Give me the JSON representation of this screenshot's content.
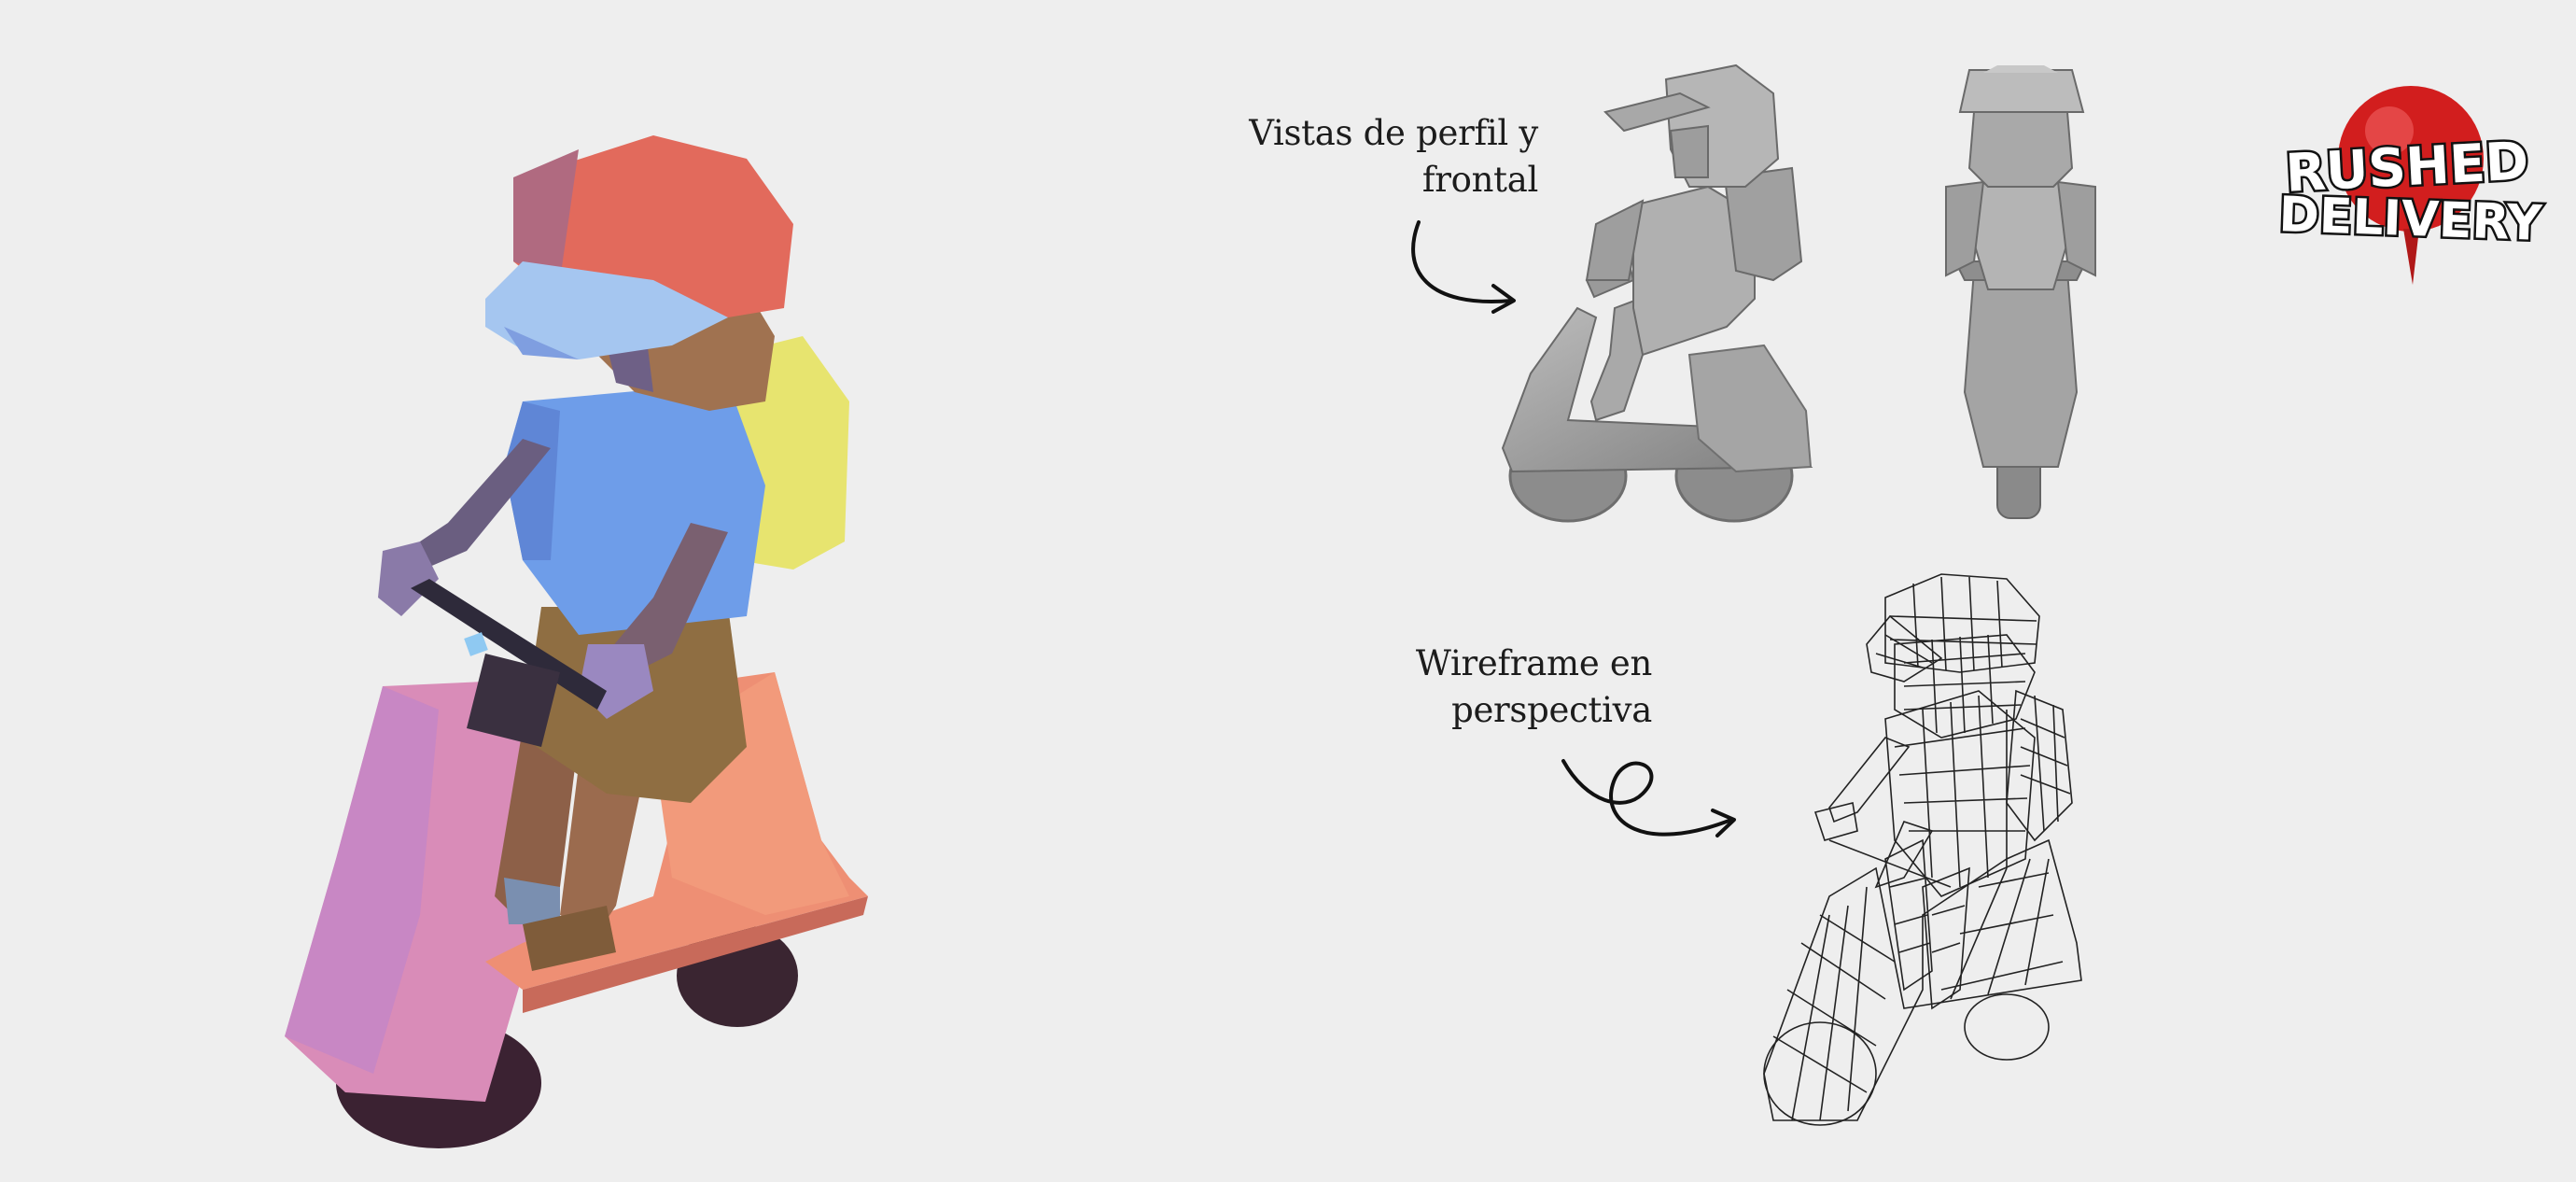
{
  "captions": {
    "profile_front": {
      "line1": "Vistas de perfil y",
      "line2": "frontal"
    },
    "wireframe": {
      "line1": "Wireframe en",
      "line2": "perspectiva"
    }
  },
  "logo": {
    "line1": "RUSHED",
    "line2": "DELIVERY"
  },
  "colors": {
    "background": "#eeeeee",
    "cap": "#e06a5c",
    "visor": "#9fc3f0",
    "shirt": "#6d9be8",
    "backpack": "#e6e36e",
    "scooter": "#ef8e73",
    "scooter_front": "#d888b6",
    "skin": "#9b6b4e",
    "shorts": "#8a6b3f",
    "gray_model": "#9a9a9a",
    "logo_red": "#d21e1e"
  },
  "icons": [
    "curved-arrow-icon",
    "loop-arrow-icon"
  ]
}
